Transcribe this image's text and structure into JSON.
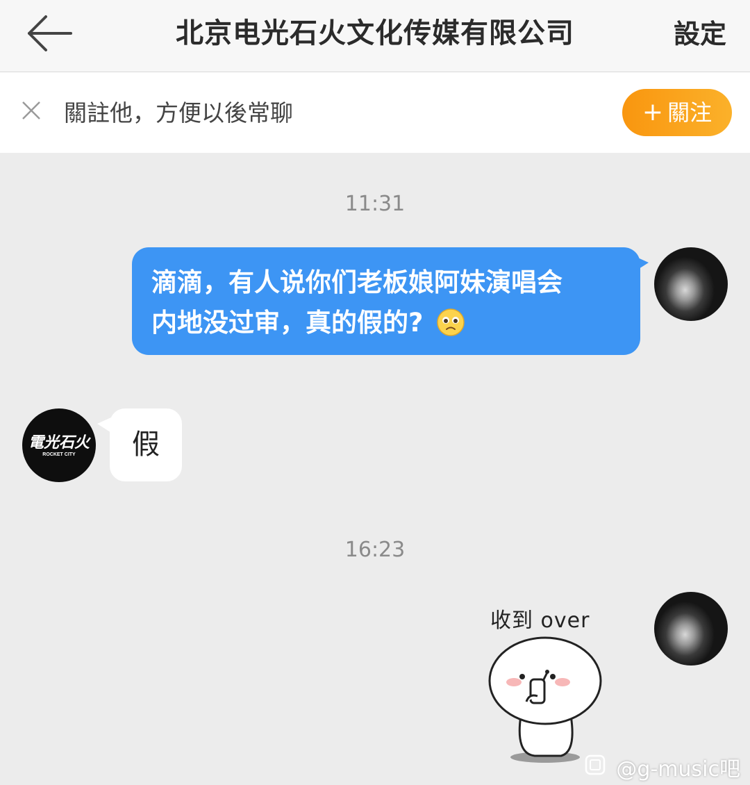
{
  "header": {
    "back_icon": "back-arrow-icon",
    "title": "北京电光石火文化传媒有限公司",
    "settings_label": "設定"
  },
  "follow_bar": {
    "close_icon": "close-icon",
    "text": "關註他，方便以後常聊",
    "button_plus": "+",
    "button_label": "關注",
    "button_color": "#f9a11b"
  },
  "messages": [
    {
      "time": "11:31"
    },
    {
      "direction": "outgoing",
      "line1": "滴滴，有人说你们老板娘阿妹演唱会",
      "line2": "内地没过审，真的假的?",
      "emoji": "pleading-face-emoji",
      "bubble_color": "#3d95f4"
    },
    {
      "direction": "incoming",
      "text": "假"
    },
    {
      "time": "16:23"
    },
    {
      "direction": "outgoing",
      "type": "sticker",
      "caption": "收到 over"
    }
  ],
  "brand_avatar": {
    "line1": "電光石火",
    "line2": "ROCKET CITY"
  },
  "watermark": "@g-music吧"
}
